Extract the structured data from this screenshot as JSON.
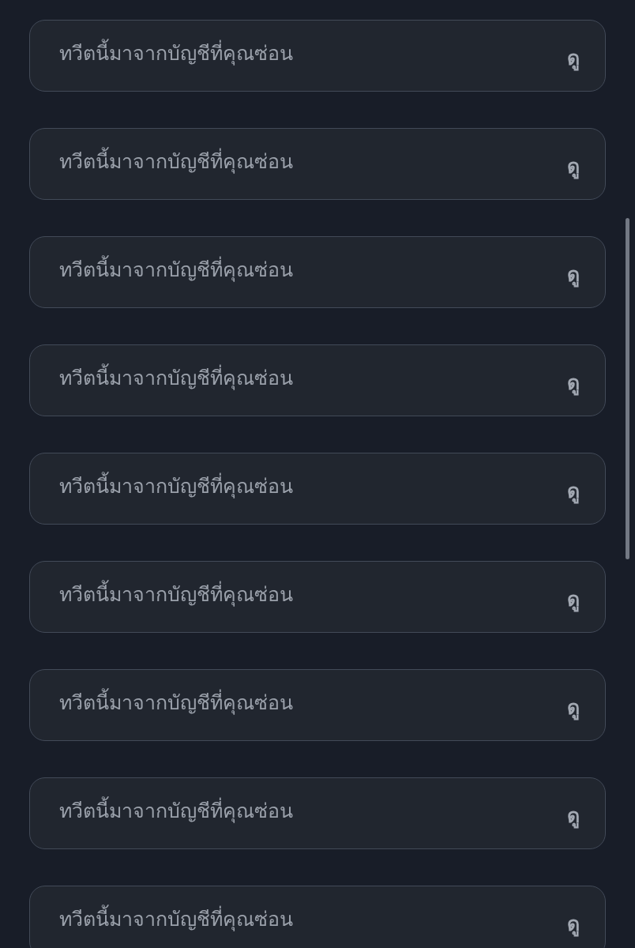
{
  "items": [
    {
      "text": "ทวีตนี้มาจากบัญชีที่คุณซ่อน",
      "action": "ดู"
    },
    {
      "text": "ทวีตนี้มาจากบัญชีที่คุณซ่อน",
      "action": "ดู"
    },
    {
      "text": "ทวีตนี้มาจากบัญชีที่คุณซ่อน",
      "action": "ดู"
    },
    {
      "text": "ทวีตนี้มาจากบัญชีที่คุณซ่อน",
      "action": "ดู"
    },
    {
      "text": "ทวีตนี้มาจากบัญชีที่คุณซ่อน",
      "action": "ดู"
    },
    {
      "text": "ทวีตนี้มาจากบัญชีที่คุณซ่อน",
      "action": "ดู"
    },
    {
      "text": "ทวีตนี้มาจากบัญชีที่คุณซ่อน",
      "action": "ดู"
    },
    {
      "text": "ทวีตนี้มาจากบัญชีที่คุณซ่อน",
      "action": "ดู"
    },
    {
      "text": "ทวีตนี้มาจากบัญชีที่คุณซ่อน",
      "action": "ดู"
    }
  ]
}
